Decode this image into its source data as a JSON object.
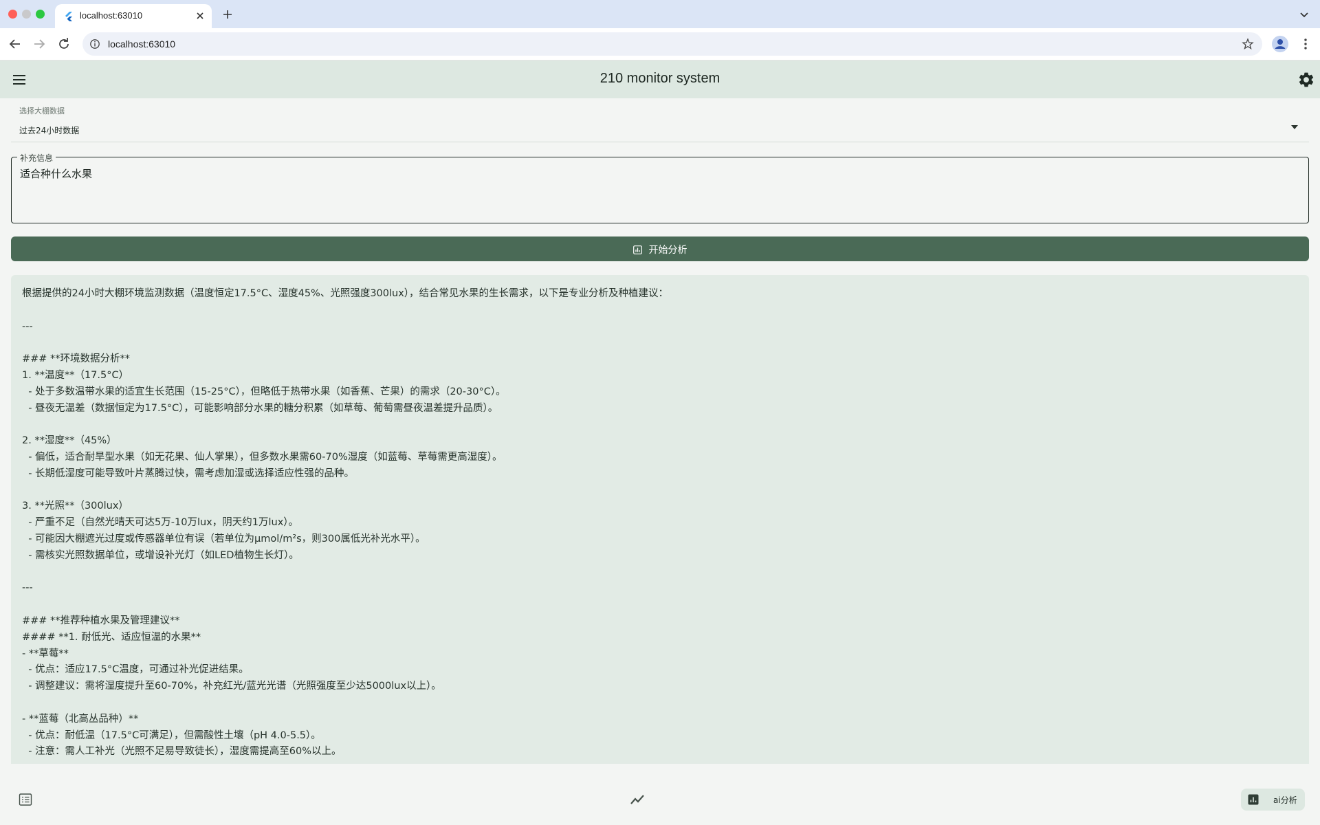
{
  "browser": {
    "tab_title": "localhost:63010",
    "url": "localhost:63010"
  },
  "app": {
    "title": "210 monitor system"
  },
  "form": {
    "select_label": "选择大棚数据",
    "select_value": "过去24小时数据",
    "extra_label": "补充信息",
    "extra_value": "适合种什么水果",
    "analyze_button": "开始分析"
  },
  "result": {
    "lines": [
      "根据提供的24小时大棚环境监测数据（温度恒定17.5°C、湿度45%、光照强度300lux），结合常见水果的生长需求，以下是专业分析及种植建议：",
      "",
      "---",
      "",
      "### **环境数据分析**",
      "1. **温度**（17.5°C）",
      "  - 处于多数温带水果的适宜生长范围（15-25°C），但略低于热带水果（如香蕉、芒果）的需求（20-30°C）。",
      "  - 昼夜无温差（数据恒定为17.5°C），可能影响部分水果的糖分积累（如草莓、葡萄需昼夜温差提升品质）。",
      "",
      "2. **湿度**（45%）",
      "  - 偏低，适合耐旱型水果（如无花果、仙人掌果），但多数水果需60-70%湿度（如蓝莓、草莓需更高湿度）。",
      "  - 长期低湿度可能导致叶片蒸腾过快，需考虑加湿或选择适应性强的品种。",
      "",
      "3. **光照**（300lux）",
      "  - 严重不足（自然光晴天可达5万-10万lux，阴天约1万lux）。",
      "  - 可能因大棚遮光过度或传感器单位有误（若单位为μmol/m²s，则300属低光补光水平）。",
      "  - 需核实光照数据单位，或增设补光灯（如LED植物生长灯）。",
      "",
      "---",
      "",
      "### **推荐种植水果及管理建议**",
      "#### **1. 耐低光、适应恒温的水果**",
      "- **草莓**",
      "  - 优点：适应17.5°C温度，可通过补光促进结果。",
      "  - 调整建议：需将湿度提升至60-70%，补充红光/蓝光光谱（光照强度至少达5000lux以上）。",
      "",
      "- **蓝莓（北高丛品种）**",
      "  - 优点：耐低温（17.5°C可满足），但需酸性土壤（pH 4.0-5.5）。",
      "  - 注意：需人工补光（光照不足易导致徒长），湿度需提高至60%以上。"
    ]
  },
  "bottom_nav": {
    "ai_label": "ai分析"
  },
  "colors": {
    "primary": "#4a6a56",
    "appbar": "#dde8e1",
    "result_bg": "#e2ebe5",
    "page_bg": "#f3f5f3"
  },
  "icons": [
    "menu-icon",
    "settings-icon",
    "dropdown-arrow-icon",
    "chart-icon",
    "list-icon",
    "trend-icon",
    "ai-chart-icon"
  ]
}
